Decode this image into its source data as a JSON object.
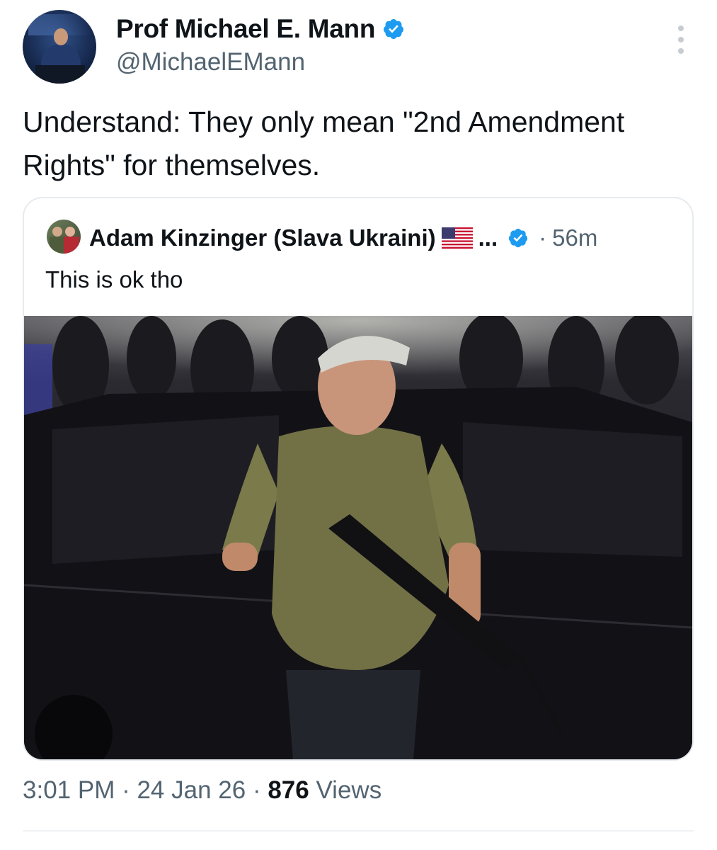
{
  "author": {
    "name": "Prof Michael E. Mann",
    "handle": "@MichaelEMann",
    "verified": true
  },
  "tweet": {
    "text": "Understand: They only mean \"2nd Amendment Rights\" for themselves."
  },
  "quoted_tweet": {
    "name": "Adam Kinzinger (Slava Ukraini)",
    "flag_icon": "us-flag-icon",
    "ellipsis": "...",
    "separator": "·",
    "time": "56m",
    "text": "This is ok tho"
  },
  "meta": {
    "time": "3:01 PM",
    "sep1": " · ",
    "date": "24 Jan 26",
    "sep2": " · ",
    "views_count": "876",
    "views_label": " Views"
  },
  "colors": {
    "verified_blue": "#1d9bf0",
    "secondary_text": "#536471",
    "primary_text": "#0f1419"
  },
  "icons": [
    "verified-badge-icon",
    "more-options-icon",
    "us-flag-icon"
  ]
}
